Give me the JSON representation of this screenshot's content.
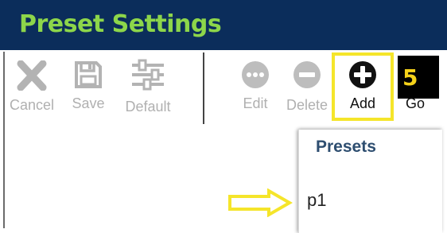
{
  "window": {
    "title": "Preset Settings"
  },
  "toolbar": {
    "cancel_label": "Cancel",
    "save_label": "Save",
    "default_label": "Default",
    "edit_label": "Edit",
    "delete_label": "Delete",
    "add_label": "Add",
    "go_label": "Go"
  },
  "annotation": {
    "step": "5"
  },
  "presets_panel": {
    "title": "Presets",
    "items": [
      {
        "label": "p1"
      }
    ]
  },
  "colors": {
    "titlebar": "#0b2d5b",
    "title_text": "#8dd64a",
    "highlight": "#f5e52a",
    "disabled": "#b0b0b0"
  }
}
